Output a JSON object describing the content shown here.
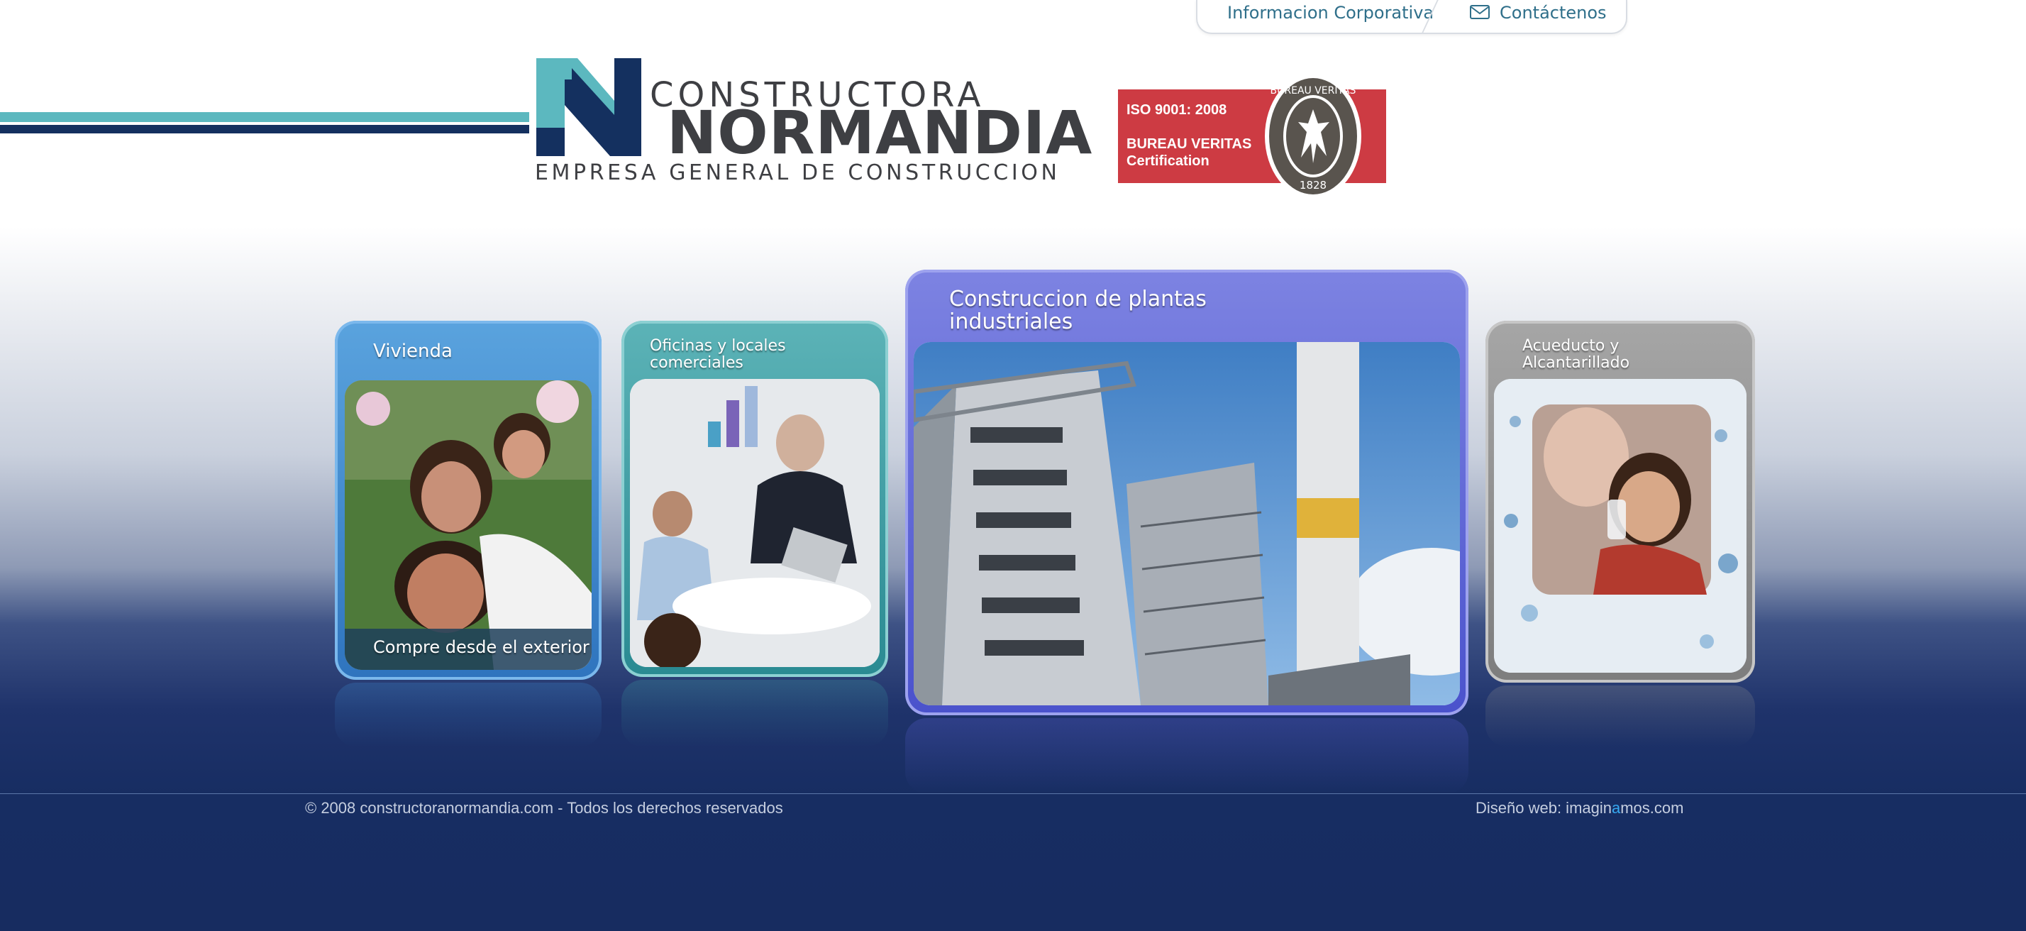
{
  "top_nav": {
    "info": "Informacion Corporativa",
    "contact": "Contáctenos"
  },
  "logo": {
    "line1": "CONSTRUCTORA",
    "line2": "NORMANDIA",
    "tagline": "EMPRESA GENERAL DE CONSTRUCCION"
  },
  "certification": {
    "line1": "ISO 9001: 2008",
    "line2": "BUREAU VERITAS",
    "line3": "Certification",
    "seal_top": "BUREAU VERITAS",
    "seal_year": "1828"
  },
  "cards": [
    {
      "title": "Vivienda",
      "caption": "Compre desde el exterior",
      "color": "#3a86cc"
    },
    {
      "title_line1": "Oficinas y locales",
      "title_line2": "comerciales",
      "color": "#3a9aa0"
    },
    {
      "title_line1": "Construccion de plantas",
      "title_line2": "industriales",
      "color": "#5a60d4"
    },
    {
      "title_line1": "Acueducto y",
      "title_line2": "Alcantarillado",
      "color": "#8e8e8e"
    }
  ],
  "footer": {
    "copyright": "© 2008 constructoranormandia.com - Todos los derechos reservados",
    "design_prefix": "Diseño web: imagin",
    "design_highlight": "a",
    "design_suffix": "mos.com"
  },
  "colors": {
    "brand_teal": "#5cb8bf",
    "brand_navy": "#14305f",
    "iso_red": "#cd3b43",
    "footer_bg": "#172c60"
  }
}
